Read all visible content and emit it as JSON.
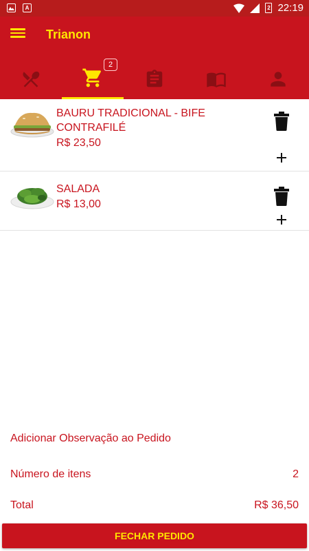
{
  "status_bar": {
    "time": "22:19",
    "battery_level": "2",
    "colors": {
      "bg": "#b71c1c"
    }
  },
  "app": {
    "title": "Trianon",
    "colors": {
      "primary": "#c8141e",
      "accent": "#ffe600",
      "tab_inactive": "#8a0f14"
    }
  },
  "tabs": [
    {
      "name": "cardapio",
      "icon": "fork-knife-icon",
      "active": false
    },
    {
      "name": "carrinho",
      "icon": "cart-icon",
      "active": true,
      "badge": "2"
    },
    {
      "name": "pedidos",
      "icon": "clipboard-icon",
      "active": false
    },
    {
      "name": "informacoes",
      "icon": "book-icon",
      "active": false
    },
    {
      "name": "perfil",
      "icon": "person-icon",
      "active": false
    }
  ],
  "cart": {
    "items": [
      {
        "name": "BAURU TRADICIONAL - BIFE CONTRAFILÉ",
        "price": "R$ 23,50",
        "image": "sandwich-image"
      },
      {
        "name": "SALADA",
        "price": "R$ 13,00",
        "image": "salad-image"
      }
    ]
  },
  "summary": {
    "observation_label": "Adicionar Observação ao Pedido",
    "item_count_label": "Número de itens",
    "item_count_value": "2",
    "total_label": "Total",
    "total_value": "R$ 36,50"
  },
  "actions": {
    "checkout_label": "FECHAR PEDIDO"
  }
}
